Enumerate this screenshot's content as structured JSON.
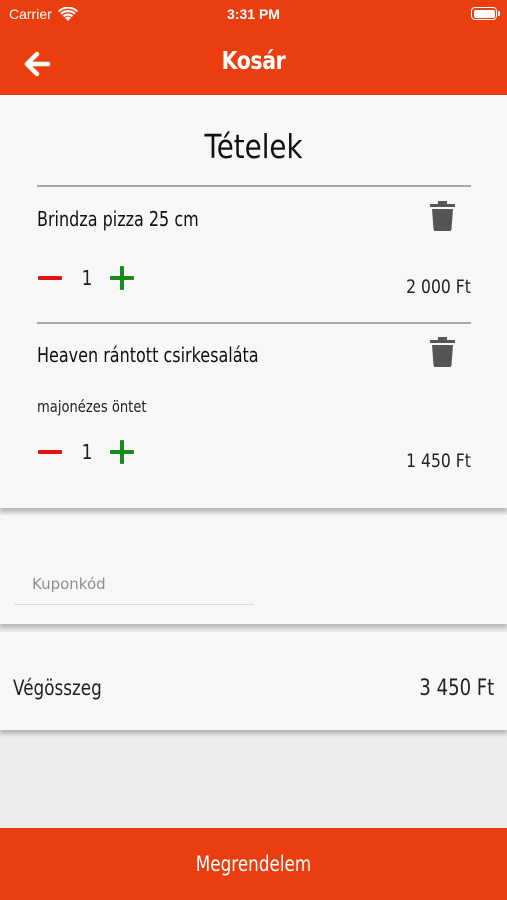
{
  "status_bar": {
    "carrier": "Carrier",
    "time": "3:31 PM"
  },
  "header": {
    "title": "Kosár",
    "back_icon": "arrow-left-icon"
  },
  "cart": {
    "title": "Tételek",
    "items": [
      {
        "name": "Brindza pizza 25 cm",
        "note": "",
        "quantity": "1",
        "price": "2 000 Ft"
      },
      {
        "name": "Heaven rántott csirkesaláta",
        "note": "majonézes öntet",
        "quantity": "1",
        "price": "1 450 Ft"
      }
    ]
  },
  "coupon": {
    "placeholder": "Kuponkód",
    "value": ""
  },
  "total": {
    "label": "Végösszeg",
    "value": "3 450 Ft"
  },
  "footer": {
    "order_label": "Megrendelem"
  },
  "colors": {
    "brand": "#ea3e10",
    "minus": "#e31414",
    "plus": "#1a8a1a",
    "trash": "#555555"
  }
}
